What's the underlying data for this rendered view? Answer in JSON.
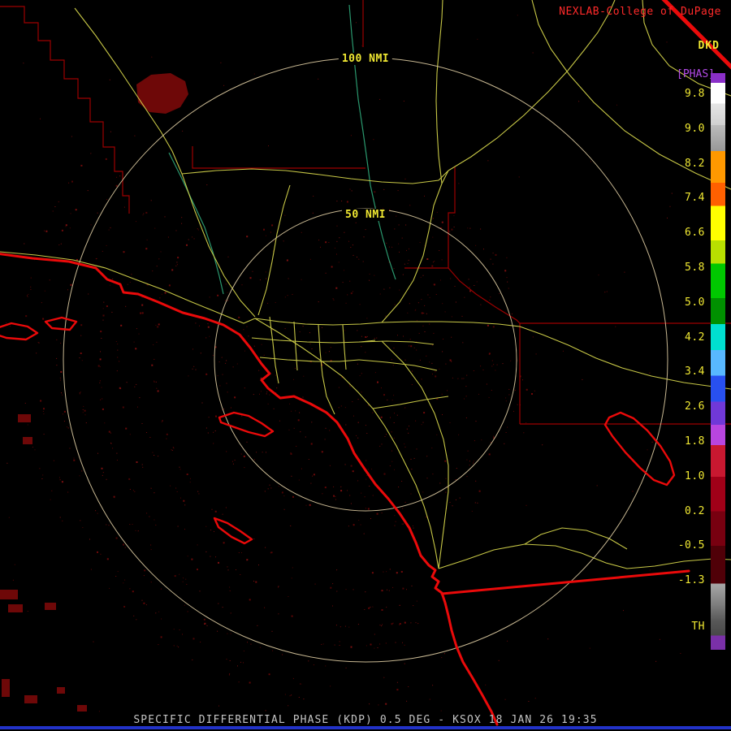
{
  "header": {
    "brand": "NEXLAB-College of DuPage",
    "station_product": "DKD",
    "product_tag": "[PHAS]"
  },
  "range_rings": {
    "outer_label": "100 NMI",
    "inner_label": "50 NMI"
  },
  "colorbar": {
    "ticks": [
      "9.8",
      "9.0",
      "8.2",
      "7.4",
      "6.6",
      "5.8",
      "5.0",
      "4.2",
      "3.4",
      "2.6",
      "1.8",
      "1.0",
      "0.2",
      "-0.5",
      "-1.3",
      "TH"
    ]
  },
  "footer": {
    "title": "SPECIFIC DIFFERENTIAL PHASE (KDP) 0.5 DEG - KSOX 18 JAN 26 19:35"
  },
  "colors": {
    "background": "#000000",
    "brand_red": "#ff2a2a",
    "label_yellow": "#f0e832",
    "tag_purple": "#b44ae8",
    "coastline_red": "#ea0a0a",
    "county_maroon": "#9c0000",
    "road_yellow": "#d2d24a",
    "river_teal": "#2fa87a",
    "ring_tan": "#d9c89e",
    "footer_gray": "#c4c4c4",
    "bottom_bar_blue": "#2232c8"
  }
}
